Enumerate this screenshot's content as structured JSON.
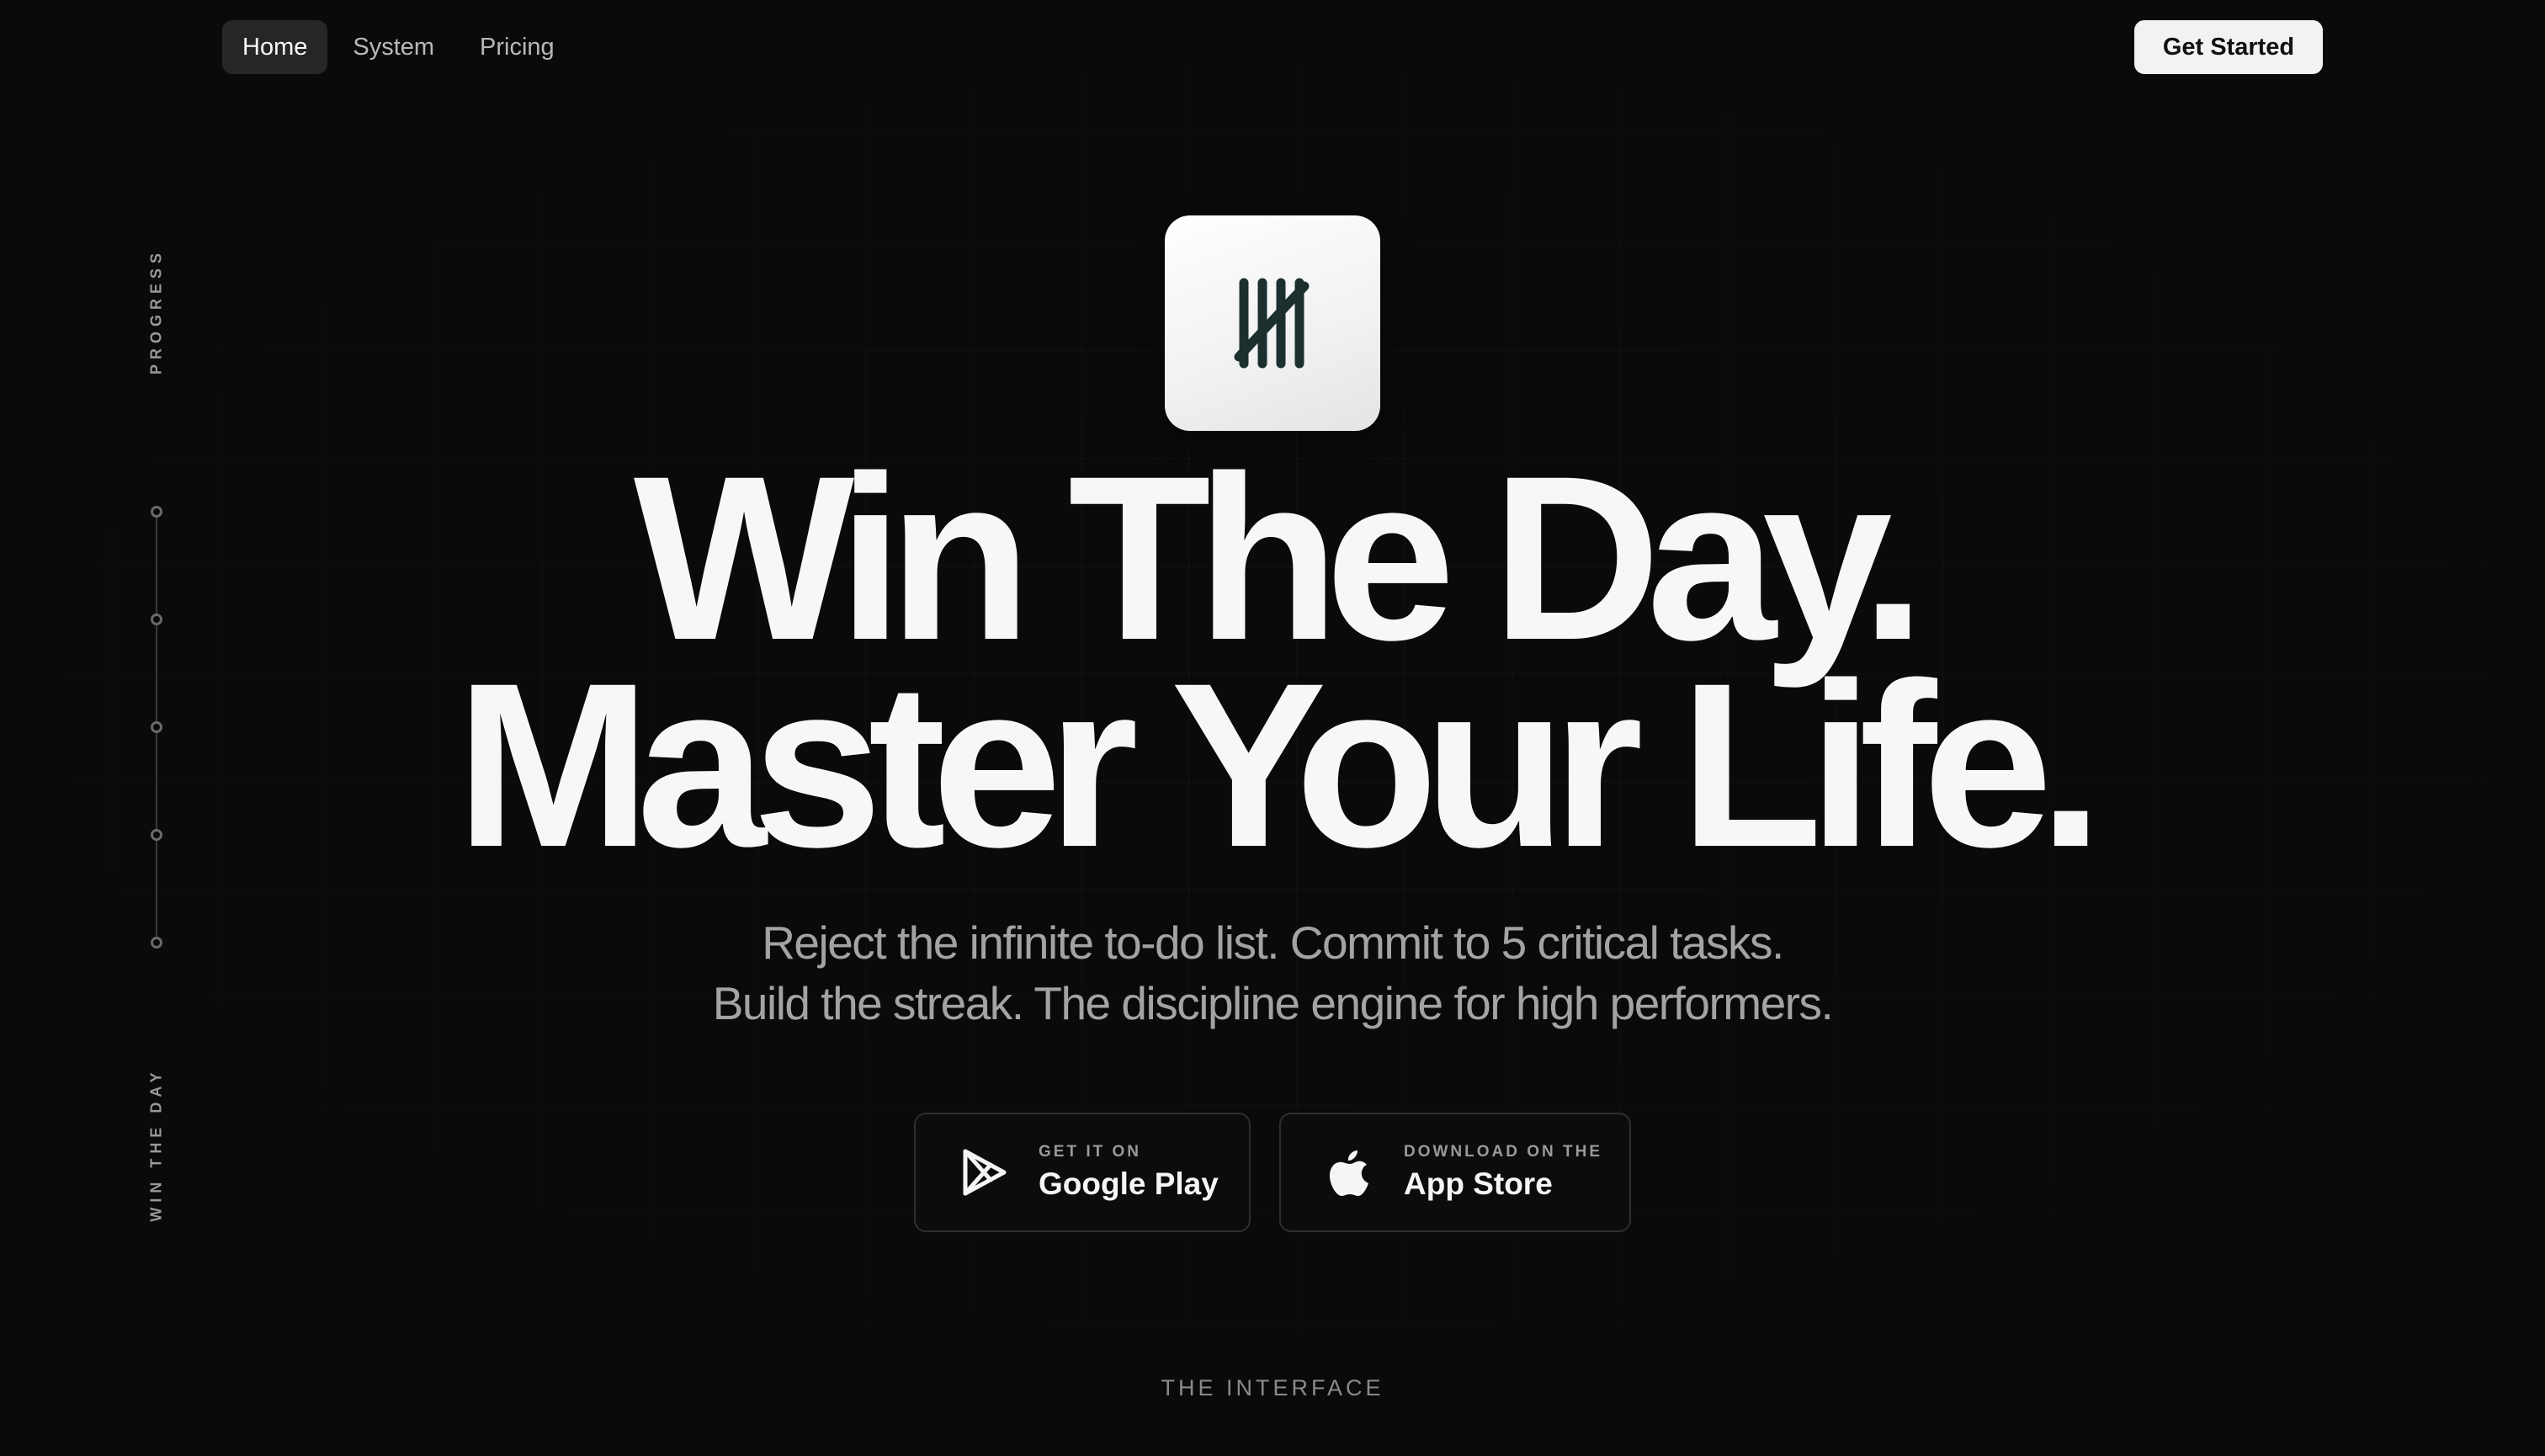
{
  "nav": {
    "items": [
      {
        "label": "Home",
        "active": true
      },
      {
        "label": "System",
        "active": false
      },
      {
        "label": "Pricing",
        "active": false
      }
    ],
    "cta_label": "Get Started"
  },
  "rail": {
    "top_label": "PROGRESS",
    "bottom_label": "WIN THE DAY"
  },
  "logo": {
    "icon": "tally-marks-icon"
  },
  "hero": {
    "headline_line1": "Win The Day.",
    "headline_line2": "Master Your Life.",
    "sub_line1": "Reject the infinite to-do list. Commit to 5 critical tasks.",
    "sub_line2": "Build the streak. The discipline engine for high performers."
  },
  "stores": {
    "google": {
      "small": "GET IT ON",
      "big": "Google Play",
      "icon": "google-play-icon"
    },
    "apple": {
      "small": "DOWNLOAD ON THE",
      "big": "App Store",
      "icon": "apple-icon"
    }
  },
  "section_label": "THE INTERFACE",
  "colors": {
    "background": "#0a0a0a",
    "text": "#fafafa",
    "muted": "#a3a3a3",
    "logo_mark": "#1c2f2f"
  }
}
